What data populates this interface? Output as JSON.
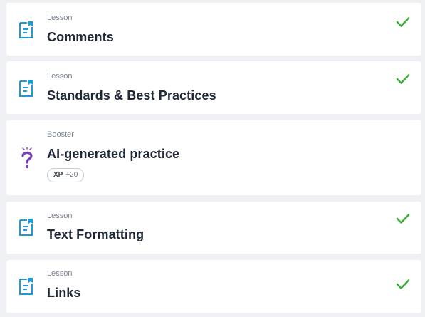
{
  "items": [
    {
      "kind": "Lesson",
      "title": "Comments",
      "icon": "lesson-icon",
      "completed": true
    },
    {
      "kind": "Lesson",
      "title": "Standards & Best Practices",
      "icon": "lesson-icon",
      "completed": true
    },
    {
      "kind": "Booster",
      "title": "AI-generated practice",
      "icon": "question-mark-icon",
      "completed": false,
      "xp": {
        "label": "XP",
        "value": "+20"
      }
    },
    {
      "kind": "Lesson",
      "title": "Text Formatting",
      "icon": "lesson-icon",
      "completed": true
    },
    {
      "kind": "Lesson",
      "title": "Links",
      "icon": "lesson-icon",
      "completed": true
    }
  ],
  "colors": {
    "lesson_icon": "#1b9bd8",
    "booster_icon": "#7b3fc4",
    "check": "#3fae3b",
    "background": "#eef0f3",
    "card": "#ffffff"
  }
}
